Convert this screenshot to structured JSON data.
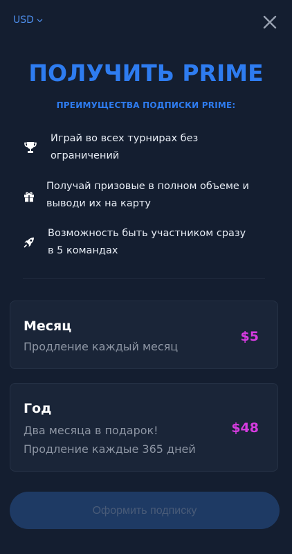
{
  "header": {
    "currency": "USD",
    "currency_icon": "chevron-down-icon",
    "close_icon": "close-icon"
  },
  "title": "ПОЛУЧИТЬ PRIME",
  "subtitle": "ПРЕИМУЩЕСТВА ПОДПИСКИ PRIME:",
  "benefits": [
    {
      "icon": "trophy-icon",
      "line1": "Играй во всех турнирах без",
      "line2": "ограничений"
    },
    {
      "icon": "gift-icon",
      "line1": "Получай призовые в полном объеме и",
      "line2": "выводи их на карту"
    },
    {
      "icon": "rocket-icon",
      "line1": "Возможность быть участником сразу",
      "line2": "в 5 командах"
    }
  ],
  "plans": {
    "month": {
      "name": "Месяц",
      "desc": "Продление каждый месяц",
      "price": "$5"
    },
    "year": {
      "name": "Год",
      "desc1": "Два месяца в подарок!",
      "desc2": "Продление каждые 365 дней",
      "price": "$48"
    }
  },
  "subscribe_label": "Оформить подписку",
  "colors": {
    "background": "#141e30",
    "accent": "#2e7cf0",
    "price": "#d63be0",
    "card": "#1a2538",
    "button_disabled": "#1e3a64"
  }
}
